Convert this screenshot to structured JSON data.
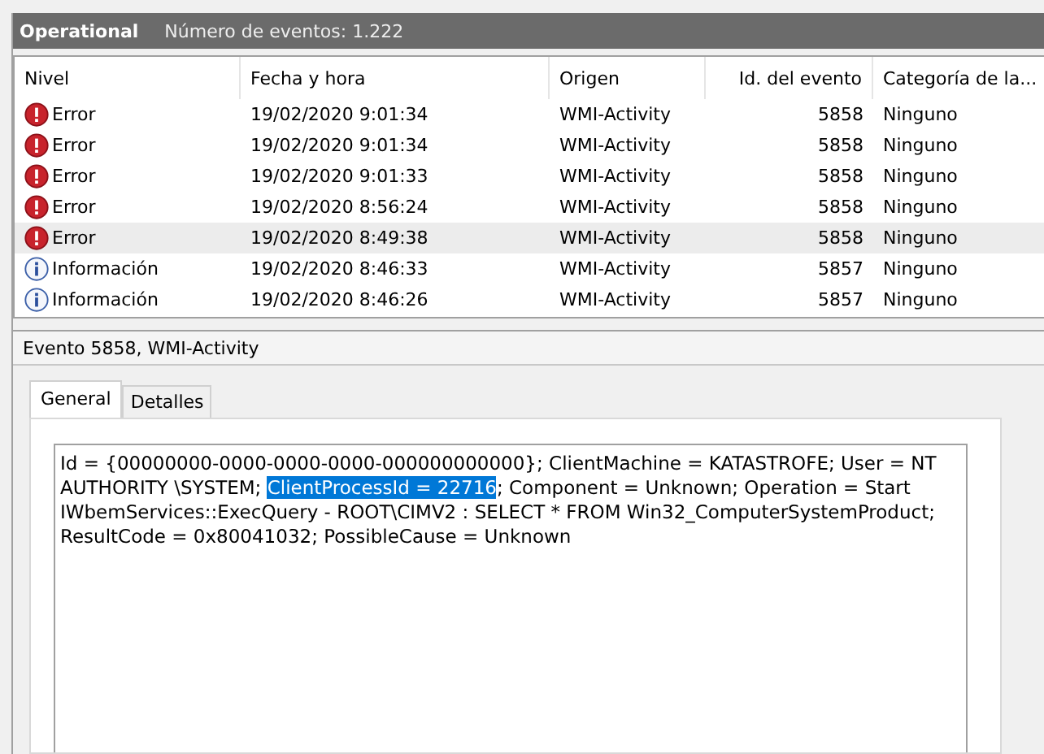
{
  "log_header": {
    "title": "Operational",
    "count": "Número de eventos: 1.222"
  },
  "table": {
    "columns": [
      "Nivel",
      "Fecha y hora",
      "Origen",
      "Id. del evento",
      "Categoría de la..."
    ],
    "rows": [
      {
        "kind": "error",
        "level": "Error",
        "date": "19/02/2020 9:01:34",
        "source": "WMI-Activity",
        "id": "5858",
        "category": "Ninguno",
        "selected": false
      },
      {
        "kind": "error",
        "level": "Error",
        "date": "19/02/2020 9:01:34",
        "source": "WMI-Activity",
        "id": "5858",
        "category": "Ninguno",
        "selected": false
      },
      {
        "kind": "error",
        "level": "Error",
        "date": "19/02/2020 9:01:33",
        "source": "WMI-Activity",
        "id": "5858",
        "category": "Ninguno",
        "selected": false
      },
      {
        "kind": "error",
        "level": "Error",
        "date": "19/02/2020 8:56:24",
        "source": "WMI-Activity",
        "id": "5858",
        "category": "Ninguno",
        "selected": false
      },
      {
        "kind": "error",
        "level": "Error",
        "date": "19/02/2020 8:49:38",
        "source": "WMI-Activity",
        "id": "5858",
        "category": "Ninguno",
        "selected": true
      },
      {
        "kind": "info",
        "level": "Información",
        "date": "19/02/2020 8:46:33",
        "source": "WMI-Activity",
        "id": "5857",
        "category": "Ninguno",
        "selected": false
      },
      {
        "kind": "info",
        "level": "Información",
        "date": "19/02/2020 8:46:26",
        "source": "WMI-Activity",
        "id": "5857",
        "category": "Ninguno",
        "selected": false
      }
    ]
  },
  "detail": {
    "title": "Evento 5858, WMI-Activity",
    "tabs": [
      {
        "label": "General",
        "selected": true
      },
      {
        "label": "Detalles",
        "selected": false
      }
    ],
    "message": [
      {
        "text": "Id = {00000000-0000-0000-0000-000000000000}; ClientMachine = KATASTROFE; User = NT AUTHORITY \\SYSTEM; ",
        "selected": false
      },
      {
        "text": "ClientProcessId = 22716",
        "selected": true
      },
      {
        "text": "; Component = Unknown; Operation = Start IWbemServices::ExecQuery - ROOT\\CIMV2 : SELECT * FROM Win32_ComputerSystemProduct; ResultCode = 0x80041032; PossibleCause = Unknown",
        "selected": false
      }
    ]
  }
}
